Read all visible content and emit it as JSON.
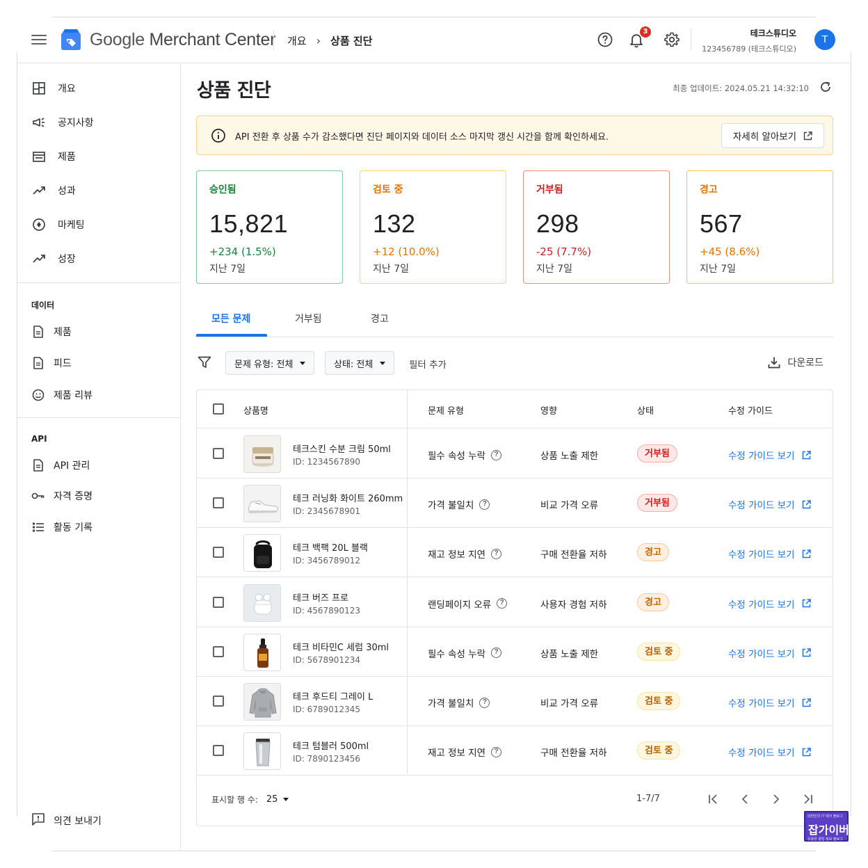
{
  "header": {
    "brand_google": "Google",
    "brand_product": "Merchant Center",
    "breadcrumb": [
      "개요",
      "상품 진단"
    ],
    "notification_count": "3",
    "account_name": "테크스튜디오",
    "account_id": "123456789 (테크스튜디오)",
    "avatar_letter": "T",
    "icons": [
      "menu-icon",
      "merchant-center-logo",
      "help-icon",
      "bell-icon",
      "gear-icon"
    ]
  },
  "sidebar": {
    "items": [
      {
        "label": "개요",
        "icon": "dashboard-icon"
      },
      {
        "label": "공지사항",
        "icon": "megaphone-icon"
      },
      {
        "label": "제품",
        "icon": "store-icon"
      },
      {
        "label": "성과",
        "icon": "trending-up-icon"
      },
      {
        "label": "마케팅",
        "icon": "marketing-icon"
      },
      {
        "label": "성장",
        "icon": "growth-icon"
      }
    ],
    "data_section": {
      "title": "데이터",
      "items": [
        {
          "label": "제품",
          "icon": "document-icon"
        },
        {
          "label": "피드",
          "icon": "document-icon"
        },
        {
          "label": "제품 리뷰",
          "icon": "review-icon"
        }
      ]
    },
    "api_section": {
      "title": "API",
      "items": [
        {
          "label": "API 관리",
          "icon": "document-icon"
        },
        {
          "label": "자격 증명",
          "icon": "key-icon"
        },
        {
          "label": "활동 기록",
          "icon": "list-icon"
        }
      ]
    },
    "feedback": "의견 보내기"
  },
  "page": {
    "title": "상품 진단",
    "last_updated": "최종 업데이트: 2024.05.21 14:32:10"
  },
  "banner": {
    "text": "API 전환 후 상품 수가 감소했다면 진단 페이지와 데이터 소스 마지막 갱신 시간을 함께 확인하세요.",
    "button": "자세히 알아보기"
  },
  "cards": [
    {
      "label": "승인됨",
      "value": "15,821",
      "change": "+234 (1.5%)",
      "period": "지난 7일",
      "color": "#188038",
      "border": "#81c995"
    },
    {
      "label": "검토 중",
      "value": "132",
      "change": "+12 (10.0%)",
      "period": "지난 7일",
      "color": "#e37400",
      "border": "#fdd663"
    },
    {
      "label": "거부됨",
      "value": "298",
      "change": "-25 (7.7%)",
      "period": "지난 7일",
      "color": "#c5221f",
      "border": "#f28b82"
    },
    {
      "label": "경고",
      "value": "567",
      "change": "+45 (8.6%)",
      "period": "지난 7일",
      "color": "#e37400",
      "border": "#fcc934"
    }
  ],
  "tabs": [
    "모든 문제",
    "거부됨",
    "경고"
  ],
  "filters": {
    "type": "문제 유형: 전체",
    "status": "상태: 전체",
    "add": "필터 추가",
    "download": "다운로드"
  },
  "table": {
    "headers": [
      "상품명",
      "문제 유형",
      "영향",
      "상태",
      "수정 가이드"
    ],
    "rows": [
      {
        "name": "테크스킨 수분 크림 50ml",
        "id": "ID: 1234567890",
        "type": "필수 속성 누락",
        "impact": "상품 노출 제한",
        "status": "거부됨",
        "status_kind": "rej",
        "guide": "수정 가이드 보기",
        "thumb": "cream-jar"
      },
      {
        "name": "테크 러닝화 화이트 260mm",
        "id": "ID: 2345678901",
        "type": "가격 불일치",
        "impact": "비교 가격 오류",
        "status": "거부됨",
        "status_kind": "rej",
        "guide": "수정 가이드 보기",
        "thumb": "sneaker"
      },
      {
        "name": "테크 백팩 20L 블랙",
        "id": "ID: 3456789012",
        "type": "재고 정보 지연",
        "impact": "구매 전환율 저하",
        "status": "경고",
        "status_kind": "warn",
        "guide": "수정 가이드 보기",
        "thumb": "backpack"
      },
      {
        "name": "테크 버즈 프로",
        "id": "ID: 4567890123",
        "type": "랜딩페이지 오류",
        "impact": "사용자 경험 저하",
        "status": "경고",
        "status_kind": "warn",
        "guide": "수정 가이드 보기",
        "thumb": "earbuds"
      },
      {
        "name": "테크 비타민C 세럼 30ml",
        "id": "ID: 5678901234",
        "type": "필수 속성 누락",
        "impact": "상품 노출 제한",
        "status": "검토 중",
        "status_kind": "rev",
        "guide": "수정 가이드 보기",
        "thumb": "serum-bottle"
      },
      {
        "name": "테크 후드티 그레이 L",
        "id": "ID: 6789012345",
        "type": "가격 불일치",
        "impact": "비교 가격 오류",
        "status": "검토 중",
        "status_kind": "rev",
        "guide": "수정 가이드 보기",
        "thumb": "hoodie"
      },
      {
        "name": "테크 텀블러 500ml",
        "id": "ID: 7890123456",
        "type": "재고 정보 지연",
        "impact": "구매 전환율 저하",
        "status": "검토 중",
        "status_kind": "rev",
        "guide": "수정 가이드 보기",
        "thumb": "tumbler"
      }
    ],
    "rows_per_page_label": "표시할 행 수:",
    "rows_per_page": "25",
    "range": "1-7/7"
  },
  "watermark": {
    "top": "대한민국 IT 테크 블로그",
    "main": "잡가이버",
    "bottom": "유용한 꿀팁 정보 블로그"
  }
}
